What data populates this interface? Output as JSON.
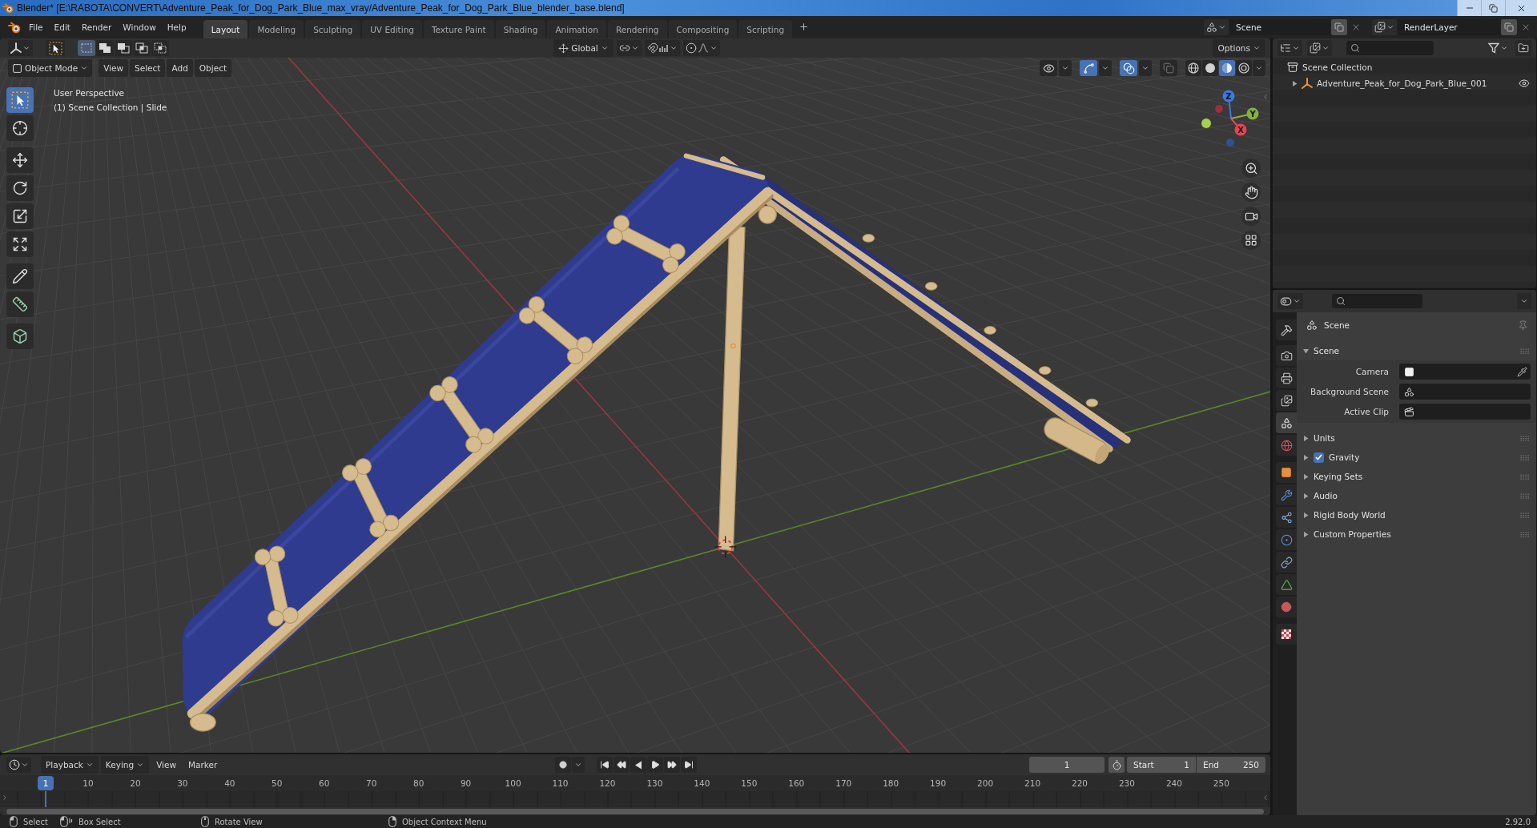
{
  "window": {
    "title": "Blender* [E:\\RABOTA\\CONVERT\\Adventure_Peak_for_Dog_Park_Blue_max_vray/Adventure_Peak_for_Dog_Park_Blue_blender_base.blend]"
  },
  "top_bar": {
    "menus": [
      "File",
      "Edit",
      "Render",
      "Window",
      "Help"
    ],
    "workspaces": [
      {
        "label": "Layout",
        "selected": true
      },
      {
        "label": "Modeling",
        "selected": false
      },
      {
        "label": "Sculpting",
        "selected": false
      },
      {
        "label": "UV Editing",
        "selected": false
      },
      {
        "label": "Texture Paint",
        "selected": false
      },
      {
        "label": "Shading",
        "selected": false
      },
      {
        "label": "Animation",
        "selected": false
      },
      {
        "label": "Rendering",
        "selected": false
      },
      {
        "label": "Compositing",
        "selected": false
      },
      {
        "label": "Scripting",
        "selected": false
      }
    ],
    "scene": "Scene",
    "view_layer": "RenderLayer"
  },
  "viewport": {
    "select_modes": [
      {
        "kind": "new",
        "selected": true
      },
      {
        "kind": "extend",
        "selected": false
      },
      {
        "kind": "subtract",
        "selected": false
      },
      {
        "kind": "invert",
        "selected": false
      },
      {
        "kind": "intersect",
        "selected": false
      }
    ],
    "orientation": "Global",
    "options": "Options",
    "mode": "Object Mode",
    "menus": [
      "View",
      "Select",
      "Add",
      "Object"
    ],
    "toggles": [
      {
        "kind": "visibility",
        "on": false
      },
      {
        "kind": "gizmos",
        "on": true
      },
      {
        "kind": "overlays",
        "on": true
      },
      {
        "kind": "xray",
        "on": false
      }
    ],
    "shading": [
      {
        "kind": "wireframe",
        "selected": false
      },
      {
        "kind": "solid",
        "selected": false
      },
      {
        "kind": "material",
        "selected": true
      },
      {
        "kind": "rendered",
        "selected": false
      }
    ],
    "tools": [
      {
        "kind": "select",
        "selected": true
      },
      {
        "kind": "cursor",
        "selected": false
      },
      {
        "kind": "move",
        "selected": false
      },
      {
        "kind": "rotate",
        "selected": false
      },
      {
        "kind": "scale",
        "selected": false
      },
      {
        "kind": "transform",
        "selected": false
      },
      {
        "kind": "annotate",
        "selected": false
      },
      {
        "kind": "measure",
        "selected": false
      },
      {
        "kind": "add_cube",
        "selected": false
      }
    ],
    "info": [
      "User Perspective",
      "(1) Scene Collection | Slide"
    ],
    "gizmo_axes": [
      {
        "label": "Z",
        "color": "#3a7be0"
      },
      {
        "label": "Y",
        "color": "#86b23a"
      },
      {
        "label": "X",
        "color": "#ec4155"
      }
    ]
  },
  "outliner": {
    "items": [
      {
        "label": "Scene Collection",
        "children": [
          {
            "label": "Adventure_Peak_for_Dog_Park_Blue_001",
            "expanded": false
          }
        ]
      }
    ]
  },
  "properties": {
    "tabs": [
      {
        "kind": "tool",
        "selected": false
      },
      {
        "kind": "render",
        "selected": false
      },
      {
        "kind": "output",
        "selected": false
      },
      {
        "kind": "view_layer",
        "selected": false
      },
      {
        "kind": "scene",
        "selected": true
      },
      {
        "kind": "world",
        "selected": false
      },
      {
        "kind": "object",
        "selected": false
      },
      {
        "kind": "modifiers",
        "selected": false
      },
      {
        "kind": "particles",
        "selected": false
      },
      {
        "kind": "physics",
        "selected": false
      },
      {
        "kind": "constraints",
        "selected": false
      },
      {
        "kind": "data",
        "selected": false
      },
      {
        "kind": "material",
        "selected": false
      },
      {
        "kind": "texture",
        "selected": false
      }
    ],
    "context": "Scene",
    "panels": [
      {
        "title": "Scene",
        "expanded": true,
        "fields": [
          {
            "label": "Camera",
            "kind": "camera"
          },
          {
            "label": "Background Scene",
            "kind": "scene"
          },
          {
            "label": "Active Clip",
            "kind": "clip"
          }
        ]
      },
      {
        "title": "Units",
        "expanded": false
      },
      {
        "title": "Gravity",
        "expanded": false,
        "checkbox": {
          "checked": true
        }
      },
      {
        "title": "Keying Sets",
        "expanded": false
      },
      {
        "title": "Audio",
        "expanded": false
      },
      {
        "title": "Rigid Body World",
        "expanded": false
      },
      {
        "title": "Custom Properties",
        "expanded": false
      }
    ]
  },
  "timeline": {
    "menus": [
      {
        "label": "Playback",
        "dropdown": true
      },
      {
        "label": "Keying",
        "dropdown": true
      },
      {
        "label": "View",
        "dropdown": false
      },
      {
        "label": "Marker",
        "dropdown": false
      }
    ],
    "current_frame": "1",
    "start": {
      "label": "Start",
      "value": "1"
    },
    "end": {
      "label": "End",
      "value": "250"
    },
    "playhead": "1",
    "ruler": [
      "10",
      "20",
      "30",
      "40",
      "50",
      "60",
      "70",
      "80",
      "90",
      "100",
      "110",
      "120",
      "130",
      "140",
      "150",
      "160",
      "170",
      "180",
      "190",
      "200",
      "210",
      "220",
      "230",
      "240",
      "250"
    ]
  },
  "status_bar": {
    "hints": [
      {
        "kind": "left_click",
        "label": "Select"
      },
      {
        "kind": "left_drag",
        "label": "Box Select"
      },
      {
        "kind": "middle_drag",
        "label": "Rotate View"
      },
      {
        "kind": "right_click",
        "label": "Object Context Menu"
      }
    ],
    "version": "2.92.0"
  }
}
